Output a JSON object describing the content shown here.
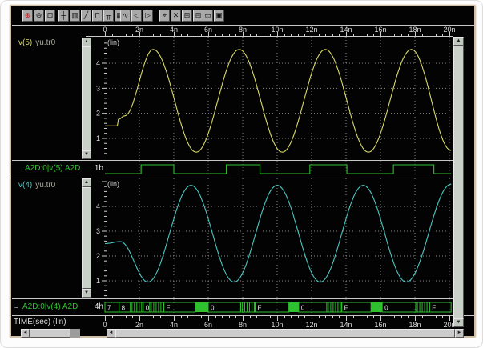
{
  "chrome": {
    "frame_color": "#cfc0a6",
    "bg": "#030303"
  },
  "toolbar": {
    "groups": [
      {
        "icons": [
          {
            "name": "zoom-in-icon",
            "glyph": "⊕",
            "accent": "#bb2222"
          },
          {
            "name": "zoom-out-icon",
            "glyph": "⊖"
          },
          {
            "name": "zoom-area-icon",
            "glyph": "⊡"
          }
        ]
      },
      {
        "icons": [
          {
            "name": "crosshair-icon",
            "glyph": "┼"
          },
          {
            "name": "ruler-icon",
            "glyph": "▥"
          },
          {
            "name": "slope-measure-icon",
            "glyph": "╱"
          },
          {
            "name": "pulse-measure-icon",
            "glyph": "⊓"
          },
          {
            "name": "marker-pair-icon",
            "glyph": "╥"
          },
          {
            "name": "grid-icon",
            "glyph": "▦"
          }
        ]
      },
      {
        "icons": [
          {
            "name": "signal-wave-icon",
            "glyph": "∿"
          },
          {
            "name": "prev-edge-icon",
            "glyph": "◁"
          },
          {
            "name": "next-edge-icon",
            "glyph": "▷"
          }
        ]
      },
      {
        "icons": [
          {
            "name": "select-point-icon",
            "glyph": "⌖"
          },
          {
            "name": "delete-icon",
            "glyph": "✕"
          },
          {
            "name": "add-panel-icon",
            "glyph": "⊞"
          },
          {
            "name": "remove-panel-icon",
            "glyph": "⊟"
          }
        ]
      },
      {
        "icons": [
          {
            "name": "expand-view-icon",
            "glyph": "▭"
          },
          {
            "name": "fit-view-icon",
            "glyph": "▣"
          }
        ]
      }
    ]
  },
  "time_axis": {
    "t_start": 0,
    "t_end": 20,
    "major_step": 2,
    "minor_step": 0.4,
    "labels": [
      "0",
      "2n",
      "4n",
      "6n",
      "8n",
      "10n",
      "12n",
      "14n",
      "16n",
      "18n",
      "20n"
    ],
    "bottom_label": "TIME(sec) (lin)"
  },
  "scrollbar": {
    "up": "▲",
    "down": "▼",
    "left": "◄",
    "right": "►"
  },
  "signals": [
    {
      "type": "analog",
      "name": "v(5)",
      "suffix": "yu.tr0",
      "color": "#d9d968",
      "scale": "(lin)",
      "yticks": [
        "4",
        "3",
        "2",
        "1"
      ],
      "keypoints": [
        [
          0,
          1.5
        ],
        [
          0.72,
          1.5
        ],
        [
          0.78,
          1.76
        ],
        [
          1.15,
          1.9
        ],
        [
          2.8,
          4.55
        ],
        [
          5.3,
          0.45
        ],
        [
          7.8,
          4.55
        ],
        [
          10.3,
          0.45
        ],
        [
          12.8,
          4.55
        ],
        [
          15.3,
          0.45
        ],
        [
          17.8,
          4.55
        ],
        [
          20.1,
          0.52
        ]
      ]
    },
    {
      "type": "digital",
      "name": "A2D:0|v(5) A2D",
      "value": "1b",
      "color": "#2fc02f",
      "segments": [
        [
          0,
          2.1,
          0
        ],
        [
          2.1,
          4.0,
          1
        ],
        [
          4.0,
          7.05,
          0
        ],
        [
          7.05,
          9.0,
          1
        ],
        [
          9.0,
          11.9,
          0
        ],
        [
          11.9,
          14.05,
          1
        ],
        [
          14.05,
          16.75,
          0
        ],
        [
          16.75,
          19.1,
          1
        ],
        [
          19.1,
          20.1,
          0
        ]
      ]
    },
    {
      "type": "analog",
      "name": "v(4)",
      "suffix": "yu.tr0",
      "color": "#49c7c0",
      "scale": "(lin)",
      "yticks": [
        "4",
        "3",
        "2",
        "1"
      ],
      "keypoints": [
        [
          0,
          2.5
        ],
        [
          0.9,
          2.58
        ],
        [
          2.5,
          0.95
        ],
        [
          5.0,
          4.85
        ],
        [
          7.5,
          0.95
        ],
        [
          10.0,
          4.85
        ],
        [
          12.5,
          0.95
        ],
        [
          15.0,
          4.85
        ],
        [
          17.5,
          0.95
        ],
        [
          20.1,
          4.9
        ]
      ]
    },
    {
      "type": "bus",
      "prefix": "=",
      "name": "A2D:0|v(4) A2D",
      "value": "4h",
      "color": "#2fc02f",
      "segments": [
        {
          "t0": 0.0,
          "t1": 0.82,
          "kind": "val",
          "label": "7"
        },
        {
          "t0": 0.82,
          "t1": 1.48,
          "kind": "val",
          "label": "8"
        },
        {
          "t0": 1.48,
          "t1": 2.22,
          "kind": "busy"
        },
        {
          "t0": 2.22,
          "t1": 2.6,
          "kind": "val",
          "label": "0"
        },
        {
          "t0": 2.6,
          "t1": 3.42,
          "kind": "busy"
        },
        {
          "t0": 3.42,
          "t1": 5.25,
          "kind": "val",
          "label": "F"
        },
        {
          "t0": 5.25,
          "t1": 6.0,
          "kind": "solid"
        },
        {
          "t0": 6.0,
          "t1": 7.88,
          "kind": "val",
          "label": "0"
        },
        {
          "t0": 7.88,
          "t1": 8.72,
          "kind": "busy"
        },
        {
          "t0": 8.72,
          "t1": 10.68,
          "kind": "val",
          "label": "F"
        },
        {
          "t0": 10.68,
          "t1": 11.25,
          "kind": "solid"
        },
        {
          "t0": 11.25,
          "t1": 12.88,
          "kind": "val",
          "label": "0"
        },
        {
          "t0": 12.88,
          "t1": 13.75,
          "kind": "busy"
        },
        {
          "t0": 13.75,
          "t1": 15.45,
          "kind": "val",
          "label": "F"
        },
        {
          "t0": 15.45,
          "t1": 16.1,
          "kind": "solid"
        },
        {
          "t0": 16.1,
          "t1": 18.05,
          "kind": "val",
          "label": "0"
        },
        {
          "t0": 18.05,
          "t1": 18.85,
          "kind": "busy"
        },
        {
          "t0": 18.85,
          "t1": 20.1,
          "kind": "val",
          "label": "F"
        }
      ]
    }
  ],
  "colors": {
    "grid": "#8a8a8a",
    "grid_dim": "#5e5e5e",
    "axis_text": "#dcdcdc",
    "panel_line": "#c8c8c8"
  }
}
